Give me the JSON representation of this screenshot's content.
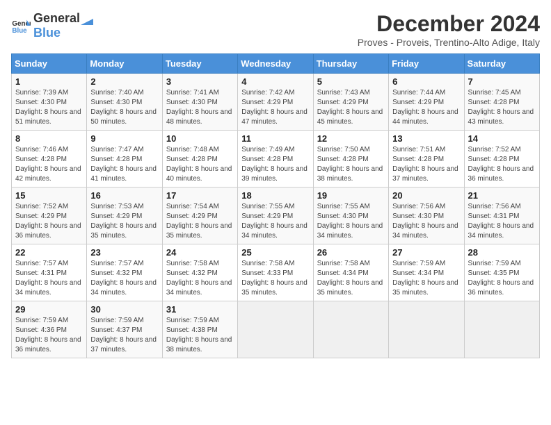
{
  "logo": {
    "general": "General",
    "blue": "Blue"
  },
  "title": "December 2024",
  "subtitle": "Proves - Proveis, Trentino-Alto Adige, Italy",
  "weekdays": [
    "Sunday",
    "Monday",
    "Tuesday",
    "Wednesday",
    "Thursday",
    "Friday",
    "Saturday"
  ],
  "weeks": [
    [
      {
        "day": "1",
        "sunrise": "7:39 AM",
        "sunset": "4:30 PM",
        "daylight": "8 hours and 51 minutes."
      },
      {
        "day": "2",
        "sunrise": "7:40 AM",
        "sunset": "4:30 PM",
        "daylight": "8 hours and 50 minutes."
      },
      {
        "day": "3",
        "sunrise": "7:41 AM",
        "sunset": "4:30 PM",
        "daylight": "8 hours and 48 minutes."
      },
      {
        "day": "4",
        "sunrise": "7:42 AM",
        "sunset": "4:29 PM",
        "daylight": "8 hours and 47 minutes."
      },
      {
        "day": "5",
        "sunrise": "7:43 AM",
        "sunset": "4:29 PM",
        "daylight": "8 hours and 45 minutes."
      },
      {
        "day": "6",
        "sunrise": "7:44 AM",
        "sunset": "4:29 PM",
        "daylight": "8 hours and 44 minutes."
      },
      {
        "day": "7",
        "sunrise": "7:45 AM",
        "sunset": "4:28 PM",
        "daylight": "8 hours and 43 minutes."
      }
    ],
    [
      {
        "day": "8",
        "sunrise": "7:46 AM",
        "sunset": "4:28 PM",
        "daylight": "8 hours and 42 minutes."
      },
      {
        "day": "9",
        "sunrise": "7:47 AM",
        "sunset": "4:28 PM",
        "daylight": "8 hours and 41 minutes."
      },
      {
        "day": "10",
        "sunrise": "7:48 AM",
        "sunset": "4:28 PM",
        "daylight": "8 hours and 40 minutes."
      },
      {
        "day": "11",
        "sunrise": "7:49 AM",
        "sunset": "4:28 PM",
        "daylight": "8 hours and 39 minutes."
      },
      {
        "day": "12",
        "sunrise": "7:50 AM",
        "sunset": "4:28 PM",
        "daylight": "8 hours and 38 minutes."
      },
      {
        "day": "13",
        "sunrise": "7:51 AM",
        "sunset": "4:28 PM",
        "daylight": "8 hours and 37 minutes."
      },
      {
        "day": "14",
        "sunrise": "7:52 AM",
        "sunset": "4:28 PM",
        "daylight": "8 hours and 36 minutes."
      }
    ],
    [
      {
        "day": "15",
        "sunrise": "7:52 AM",
        "sunset": "4:29 PM",
        "daylight": "8 hours and 36 minutes."
      },
      {
        "day": "16",
        "sunrise": "7:53 AM",
        "sunset": "4:29 PM",
        "daylight": "8 hours and 35 minutes."
      },
      {
        "day": "17",
        "sunrise": "7:54 AM",
        "sunset": "4:29 PM",
        "daylight": "8 hours and 35 minutes."
      },
      {
        "day": "18",
        "sunrise": "7:55 AM",
        "sunset": "4:29 PM",
        "daylight": "8 hours and 34 minutes."
      },
      {
        "day": "19",
        "sunrise": "7:55 AM",
        "sunset": "4:30 PM",
        "daylight": "8 hours and 34 minutes."
      },
      {
        "day": "20",
        "sunrise": "7:56 AM",
        "sunset": "4:30 PM",
        "daylight": "8 hours and 34 minutes."
      },
      {
        "day": "21",
        "sunrise": "7:56 AM",
        "sunset": "4:31 PM",
        "daylight": "8 hours and 34 minutes."
      }
    ],
    [
      {
        "day": "22",
        "sunrise": "7:57 AM",
        "sunset": "4:31 PM",
        "daylight": "8 hours and 34 minutes."
      },
      {
        "day": "23",
        "sunrise": "7:57 AM",
        "sunset": "4:32 PM",
        "daylight": "8 hours and 34 minutes."
      },
      {
        "day": "24",
        "sunrise": "7:58 AM",
        "sunset": "4:32 PM",
        "daylight": "8 hours and 34 minutes."
      },
      {
        "day": "25",
        "sunrise": "7:58 AM",
        "sunset": "4:33 PM",
        "daylight": "8 hours and 35 minutes."
      },
      {
        "day": "26",
        "sunrise": "7:58 AM",
        "sunset": "4:34 PM",
        "daylight": "8 hours and 35 minutes."
      },
      {
        "day": "27",
        "sunrise": "7:59 AM",
        "sunset": "4:34 PM",
        "daylight": "8 hours and 35 minutes."
      },
      {
        "day": "28",
        "sunrise": "7:59 AM",
        "sunset": "4:35 PM",
        "daylight": "8 hours and 36 minutes."
      }
    ],
    [
      {
        "day": "29",
        "sunrise": "7:59 AM",
        "sunset": "4:36 PM",
        "daylight": "8 hours and 36 minutes."
      },
      {
        "day": "30",
        "sunrise": "7:59 AM",
        "sunset": "4:37 PM",
        "daylight": "8 hours and 37 minutes."
      },
      {
        "day": "31",
        "sunrise": "7:59 AM",
        "sunset": "4:38 PM",
        "daylight": "8 hours and 38 minutes."
      },
      null,
      null,
      null,
      null
    ]
  ],
  "labels": {
    "sunrise": "Sunrise:",
    "sunset": "Sunset:",
    "daylight": "Daylight:"
  },
  "accent_color": "#4a90d9"
}
